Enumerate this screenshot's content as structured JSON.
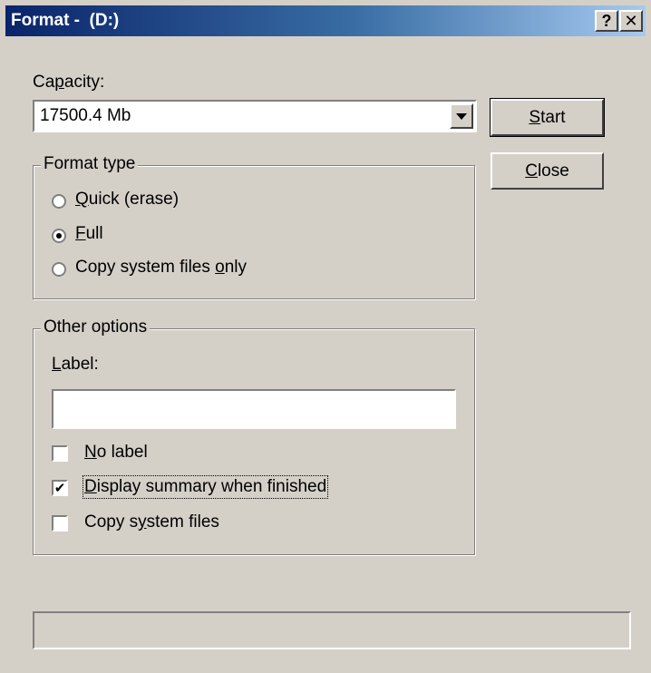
{
  "window": {
    "title": "Format -  (D:)",
    "help_label": "?",
    "close_label": "✕"
  },
  "capacity": {
    "label_pre": "Ca",
    "label_u": "p",
    "label_post": "acity:",
    "selected": "17500.4 Mb"
  },
  "buttons": {
    "start_u": "S",
    "start_rest": "tart",
    "close_u": "C",
    "close_rest": "lose"
  },
  "format_type": {
    "title": "Format type",
    "options": [
      {
        "pre": "",
        "u": "Q",
        "post": "uick (erase)",
        "selected": false
      },
      {
        "pre": "",
        "u": "F",
        "post": "ull",
        "selected": true
      },
      {
        "pre": "Copy system files ",
        "u": "o",
        "post": "nly",
        "selected": false
      }
    ]
  },
  "other_options": {
    "title": "Other options",
    "label_u": "L",
    "label_rest": "abel:",
    "label_value": "",
    "checkboxes": [
      {
        "pre": "",
        "u": "N",
        "post": "o label",
        "checked": false
      },
      {
        "pre": "",
        "u": "D",
        "post": "isplay summary when finished",
        "checked": true
      },
      {
        "pre": "Copy s",
        "u": "y",
        "post": "stem files",
        "checked": false
      }
    ]
  },
  "status": {
    "progress": 0
  }
}
